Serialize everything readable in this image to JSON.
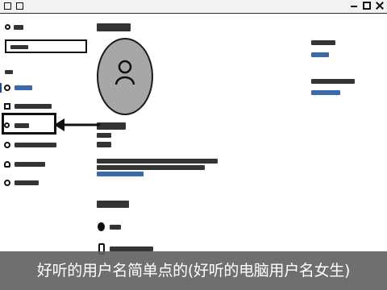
{
  "caption": {
    "text": "好听的用户名简单点的(好听的电脑用户名女生)"
  },
  "colors": {
    "accent": "#1a4f9c",
    "caption_bg": "#5f5f5f",
    "avatar_bg": "#a7a7a7"
  },
  "icons": {
    "back": "back-arrow-icon",
    "home": "home-icon",
    "avatar": "default-user-icon",
    "sign_in_face": "face-icon",
    "sign_in_phone": "phone-icon"
  }
}
